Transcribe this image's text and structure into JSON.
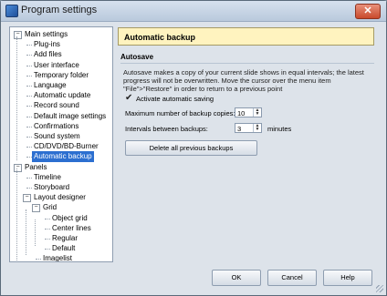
{
  "window": {
    "title": "Program settings",
    "close_label": "✕"
  },
  "tree": {
    "items": [
      {
        "label": "Main settings",
        "expander": "−"
      },
      {
        "label": "Plug-ins"
      },
      {
        "label": "Add files"
      },
      {
        "label": "User interface"
      },
      {
        "label": "Temporary folder"
      },
      {
        "label": "Language"
      },
      {
        "label": "Automatic update"
      },
      {
        "label": "Record sound"
      },
      {
        "label": "Default image settings"
      },
      {
        "label": "Confirmations"
      },
      {
        "label": "Sound system"
      },
      {
        "label": "CD/DVD/BD-Burner"
      },
      {
        "label": "Automatic backup",
        "selected": true
      },
      {
        "label": "Panels",
        "expander": "−"
      },
      {
        "label": "Timeline"
      },
      {
        "label": "Storyboard"
      },
      {
        "label": "Layout designer",
        "expander": "−"
      },
      {
        "label": "Grid",
        "expander": "−"
      },
      {
        "label": "Object grid"
      },
      {
        "label": "Center lines"
      },
      {
        "label": "Regular"
      },
      {
        "label": "Default"
      },
      {
        "label": "Imagelist"
      }
    ]
  },
  "content": {
    "header": "Automatic backup",
    "section_title": "Autosave",
    "description": "Autosave makes a copy of your current slide shows in equal intervals; the latest progress will not be overwritten. Move the cursor over the menu item \"File\">\"Restore\" in order to return to a previous point",
    "checkbox_label": "Activate automatic saving",
    "checkbox_checked": true,
    "max_copies_label": "Maximum number of backup copies:",
    "max_copies_value": "10",
    "interval_label": "Intervals between backups:",
    "interval_value": "3",
    "interval_unit": "minutes",
    "delete_button": "Delete all previous backups"
  },
  "footer": {
    "ok": "OK",
    "cancel": "Cancel",
    "help": "Help"
  }
}
